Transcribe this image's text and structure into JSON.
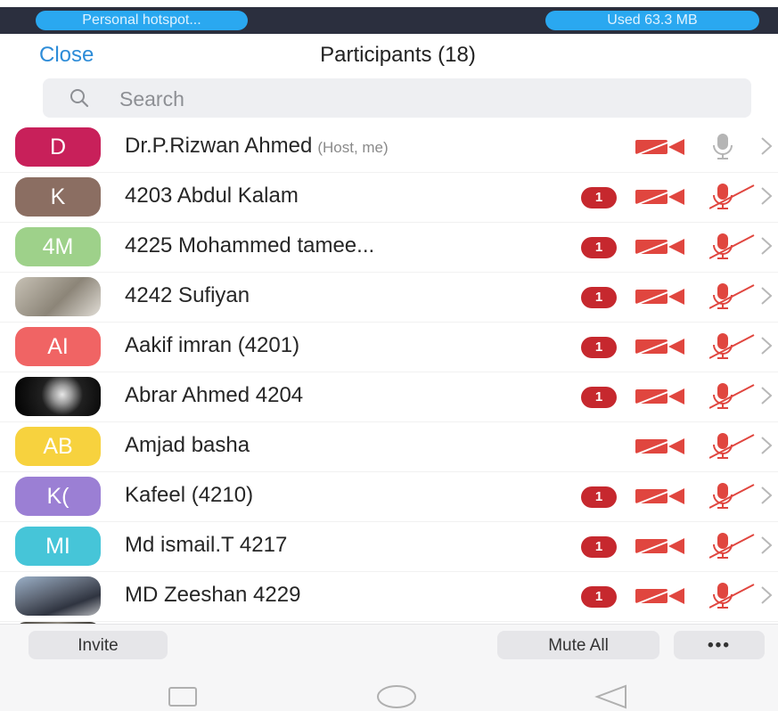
{
  "status_bar": {
    "left_pill": "Personal hotspot...",
    "right_pill": "Used  63.3 MB"
  },
  "nav": {
    "close_label": "Close",
    "title": "Participants (18)"
  },
  "search": {
    "placeholder": "Search"
  },
  "participants": [
    {
      "avatar_text": "D",
      "avatar_color": "#c8205a",
      "name": "Dr.P.Rizwan Ahmed",
      "tag": "(Host, me)",
      "badge": "",
      "mic_muted": false
    },
    {
      "avatar_text": "K",
      "avatar_color": "#8b6e62",
      "name": "4203 Abdul Kalam",
      "tag": "",
      "badge": "1",
      "mic_muted": true
    },
    {
      "avatar_text": "4M",
      "avatar_color": "#9ed18a",
      "name": "4225 Mohammed tamee...",
      "tag": "",
      "badge": "1",
      "mic_muted": true
    },
    {
      "avatar_text": "",
      "avatar_color": "photo",
      "name": "4242 Sufiyan",
      "tag": "",
      "badge": "1",
      "mic_muted": true
    },
    {
      "avatar_text": "AI",
      "avatar_color": "#f06464",
      "name": "Aakif imran (4201)",
      "tag": "",
      "badge": "1",
      "mic_muted": true
    },
    {
      "avatar_text": "",
      "avatar_color": "photo-dark",
      "name": "Abrar Ahmed 4204",
      "tag": "",
      "badge": "1",
      "mic_muted": true
    },
    {
      "avatar_text": "AB",
      "avatar_color": "#f7d23e",
      "name": "Amjad basha",
      "tag": "",
      "badge": "",
      "mic_muted": true
    },
    {
      "avatar_text": "K(",
      "avatar_color": "#9b7fd4",
      "name": "Kafeel (4210)",
      "tag": "",
      "badge": "1",
      "mic_muted": true
    },
    {
      "avatar_text": "MI",
      "avatar_color": "#46c5d8",
      "name": "Md ismail.T 4217",
      "tag": "",
      "badge": "1",
      "mic_muted": true
    },
    {
      "avatar_text": "",
      "avatar_color": "photo-bike",
      "name": "MD Zeeshan 4229",
      "tag": "",
      "badge": "1",
      "mic_muted": true
    }
  ],
  "bottom_bar": {
    "invite_label": "Invite",
    "mute_all_label": "Mute All",
    "more_label": "•••"
  },
  "colors": {
    "accent": "#2d8cd8",
    "badge": "#c6282e",
    "muted_icon": "#e0463f",
    "unmuted_mic": "#b5b5b5"
  },
  "icons": {
    "search": "search-icon",
    "camera_off": "video-off-icon",
    "mic_muted": "mic-muted-icon",
    "mic": "mic-icon",
    "chevron": "chevron-right-icon"
  }
}
